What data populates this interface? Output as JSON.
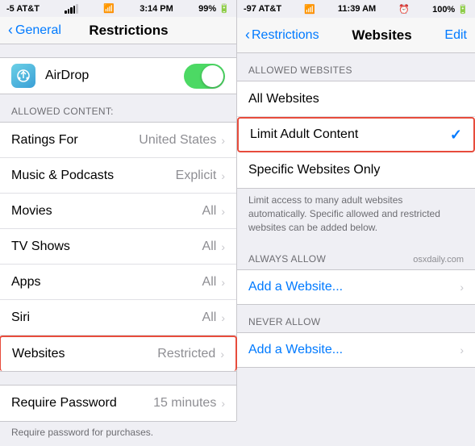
{
  "left": {
    "statusBar": {
      "carrier": "-5 AT&T",
      "signal": "●●●●○",
      "wifi": "wifi",
      "time": "3:14 PM",
      "batteryPercent": "99%",
      "batteryIcon": "🔋"
    },
    "navBack": "General",
    "navTitle": "Restrictions",
    "airdrop": {
      "label": "AirDrop",
      "toggleOn": true
    },
    "allowedContentHeader": "ALLOWED CONTENT:",
    "rows": [
      {
        "label": "Ratings For",
        "value": "United States",
        "hasChevron": true
      },
      {
        "label": "Music & Podcasts",
        "value": "Explicit",
        "hasChevron": true
      },
      {
        "label": "Movies",
        "value": "All",
        "hasChevron": true
      },
      {
        "label": "TV Shows",
        "value": "All",
        "hasChevron": true
      },
      {
        "label": "Apps",
        "value": "All",
        "hasChevron": true
      },
      {
        "label": "Siri",
        "value": "All",
        "hasChevron": true
      },
      {
        "label": "Websites",
        "value": "Restricted",
        "hasChevron": true,
        "highlighted": true
      }
    ],
    "requireRows": [
      {
        "label": "Require Password",
        "value": "15 minutes",
        "hasChevron": true
      }
    ],
    "requireNote": "Require password for purchases."
  },
  "right": {
    "statusBar": {
      "carrier": "-97 AT&T",
      "wifi": "wifi",
      "time": "11:39 AM",
      "alarm": "⏰",
      "batteryPercent": "100%"
    },
    "navBack": "Restrictions",
    "navTitle": "Websites",
    "navEdit": "Edit",
    "allowedWebsitesHeader": "ALLOWED WEBSITES",
    "allowedRows": [
      {
        "label": "All Websites",
        "hasChevron": false,
        "checked": false
      },
      {
        "label": "Limit Adult Content",
        "hasChevron": false,
        "checked": true,
        "highlighted": true
      },
      {
        "label": "Specific Websites Only",
        "hasChevron": false,
        "checked": false
      }
    ],
    "description": "Limit access to many adult websites automatically. Specific allowed and restricted websites can be added below.",
    "alwaysAllowHeader": "ALWAYS ALLOW",
    "osxdailyNote": "osxdaily.com",
    "alwaysAllowRows": [
      {
        "label": "Add a Website...",
        "hasChevron": true
      }
    ],
    "neverAllowHeader": "NEVER ALLOW",
    "neverAllowRows": [
      {
        "label": "Add a Website...",
        "hasChevron": true
      }
    ]
  }
}
